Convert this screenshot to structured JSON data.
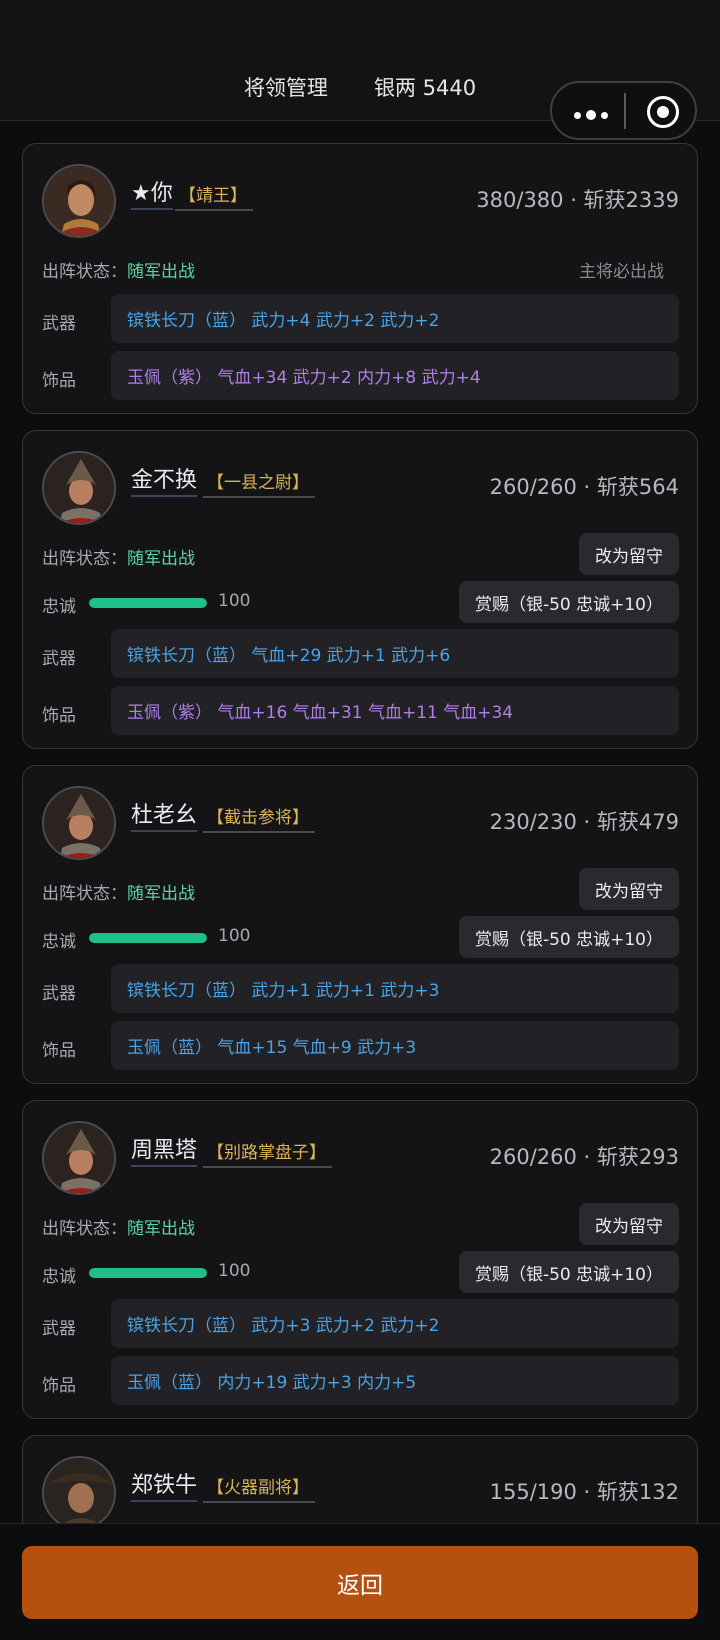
{
  "header": {
    "title": "将领管理",
    "silver": "银两 5440"
  },
  "labels": {
    "status": "出阵状态：",
    "loyalty": "忠诚",
    "weapon": "武器",
    "accessory": "饰品",
    "back": "返回"
  },
  "generals": [
    {
      "name": "★你",
      "title": "【靖王】",
      "stats": "380/380 · 斩获2339",
      "status": "随军出战",
      "must_deploy": "主将必出战",
      "weapon": "镔铁长刀（蓝） 武力+4 武力+2 武力+2",
      "weapon_color": "#4aa3e6",
      "accessory": "玉佩（紫） 气血+34 武力+2 内力+8 武力+4",
      "accessory_color": "#b07ee8"
    },
    {
      "name": "金不换",
      "title": "【一县之尉】",
      "stats": "260/260 · 斩获564",
      "status": "随军出战",
      "action": "改为留守",
      "loyalty": "100",
      "loyalty_level": 1.0,
      "reward": "赏赐（银-50 忠诚+10）",
      "weapon": "镔铁长刀（蓝） 气血+29 武力+1 武力+6",
      "weapon_color": "#4aa3e6",
      "accessory": "玉佩（紫） 气血+16 气血+31 气血+11 气血+34",
      "accessory_color": "#b07ee8"
    },
    {
      "name": "杜老幺",
      "title": "【截击参将】",
      "stats": "230/230 · 斩获479",
      "status": "随军出战",
      "action": "改为留守",
      "loyalty": "100",
      "loyalty_level": 1.0,
      "reward": "赏赐（银-50 忠诚+10）",
      "weapon": "镔铁长刀（蓝） 武力+1 武力+1 武力+3",
      "weapon_color": "#4aa3e6",
      "accessory": "玉佩（蓝） 气血+15 气血+9 武力+3",
      "accessory_color": "#4aa3e6"
    },
    {
      "name": "周黑塔",
      "title": "【别路掌盘子】",
      "stats": "260/260 · 斩获293",
      "status": "随军出战",
      "action": "改为留守",
      "loyalty": "100",
      "loyalty_level": 1.0,
      "reward": "赏赐（银-50 忠诚+10）",
      "weapon": "镔铁长刀（蓝） 武力+3 武力+2 武力+2",
      "weapon_color": "#4aa3e6",
      "accessory": "玉佩（蓝） 内力+19 武力+3 内力+5",
      "accessory_color": "#4aa3e6"
    },
    {
      "name": "郑铁牛",
      "title": "【火器副将】",
      "stats": "155/190 · 斩获132"
    }
  ]
}
